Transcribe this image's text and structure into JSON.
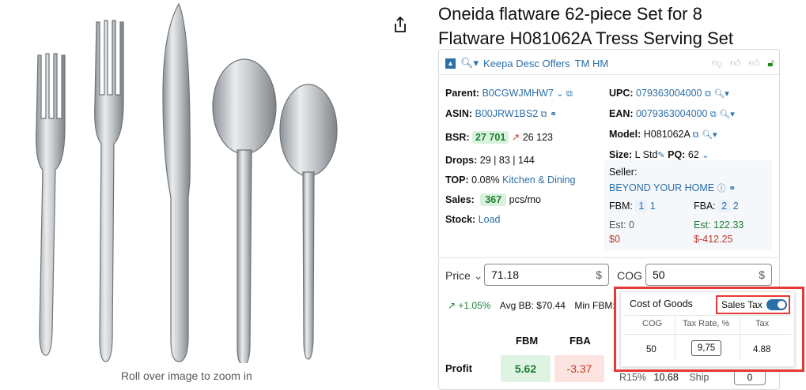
{
  "image": {
    "caption": "Roll over image to zoom in"
  },
  "title": {
    "line1": "Oneida flatware 62-piece Set for 8",
    "line2": "Flatware H081062A Tress Serving Set"
  },
  "keepa": {
    "toolbar_label": "Keepa Desc Offers",
    "toolbar_label2": "TM HM",
    "parent_label": "Parent:",
    "parent_value": "B0CGWJMHW7",
    "asin_label": "ASIN:",
    "asin_value": "B00JRW1BS2",
    "bsr_label": "BSR:",
    "bsr_value": "27 701",
    "bsr_trend": "26 123",
    "drops_label": "Drops:",
    "drops_value": "29 | 83 | 144",
    "top_label": "TOP:",
    "top_value": "0.08%",
    "top_category": "Kitchen & Dining",
    "sales_label": "Sales:",
    "sales_value": "367",
    "sales_unit": "pcs/mo",
    "stock_label": "Stock:",
    "stock_value": "Load",
    "upc_label": "UPC:",
    "upc_value": "079363004000",
    "ean_label": "EAN:",
    "ean_value": "0079363004000",
    "model_label": "Model:",
    "model_value": "H081062A",
    "size_label": "Size:",
    "size_value": "L Std",
    "pq_label": "PQ:",
    "pq_value": "62",
    "seller_label": "Seller:",
    "seller_name": "BEYOND YOUR HOME",
    "fbm_label": "FBM:",
    "fbm_count1": "1",
    "fbm_count2": "1",
    "fba_label": "FBA:",
    "fba_count1": "2",
    "fba_count2": "2",
    "fbm_est": "Est: 0",
    "fbm_profit": "$0",
    "fba_est": "Est: 122.33",
    "fba_profit": "$-412.25"
  },
  "pricing": {
    "price_label": "Price",
    "price_value": "71.18",
    "price_unit": "$",
    "cog_label": "COG",
    "cog_value": "50",
    "cog_unit": "$",
    "trend_value": "+1.05%",
    "avg_bb": "Avg BB: $70.44",
    "min_fbm": "Min FBM: $"
  },
  "profit": {
    "fbm_header": "FBM",
    "fba_header": "FBA",
    "row_label": "Profit",
    "fbm_value": "5.62",
    "fba_value": "-3.37",
    "r15_label": "R15%",
    "r15_value": "10.68",
    "ship_label": "Ship",
    "ship_value": "0"
  },
  "cog_popup": {
    "title": "Cost of Goods",
    "sales_tax_label": "Sales Tax",
    "col_cog": "COG",
    "col_rate": "Tax Rate, %",
    "col_tax": "Tax",
    "cog_value": "50",
    "rate_value": "9,75",
    "tax_value": "4.88"
  },
  "colors": {
    "accent": "#2a6fa8",
    "highlight_border": "#e53935",
    "green": "#1e7e34",
    "red": "#c0392b"
  }
}
